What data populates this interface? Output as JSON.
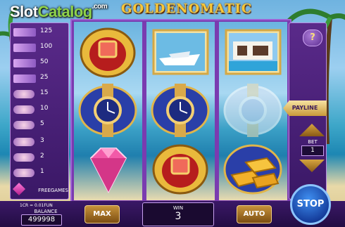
{
  "branding": {
    "site_slot": "Slot",
    "site_catalog": "Catalog",
    "site_com": ".com",
    "game_title": "GOLDENOMATIC"
  },
  "paytable": [
    {
      "value": "125"
    },
    {
      "value": "100"
    },
    {
      "value": "50"
    },
    {
      "value": "25"
    },
    {
      "value": "15"
    },
    {
      "value": "10"
    },
    {
      "value": "5"
    },
    {
      "value": "3"
    },
    {
      "value": "2"
    },
    {
      "value": "1"
    }
  ],
  "paytable_free": "FREEGAMES",
  "reels": [
    [
      "ring-symbol",
      "watch-symbol",
      "diamond-symbol"
    ],
    [
      "yacht-symbol",
      "watch-symbol",
      "ring-symbol"
    ],
    [
      "villa-symbol",
      "watch-symbol-dimmed",
      "gold-bars-symbol"
    ]
  ],
  "controls": {
    "help": "?",
    "payline": "PAYLINE",
    "bet_label": "BET",
    "bet_value": "1",
    "cr_info": "1CR = 0.01FUN",
    "balance_label": "BALANCE",
    "balance_value": "499998",
    "max": "MAX",
    "win_label": "WIN",
    "win_value": "3",
    "auto": "AUTO",
    "stop": "STOP"
  },
  "colors": {
    "panel": "#5a2a8a",
    "gold": "#f8c83a",
    "stop_blue": "#1d55c9"
  }
}
